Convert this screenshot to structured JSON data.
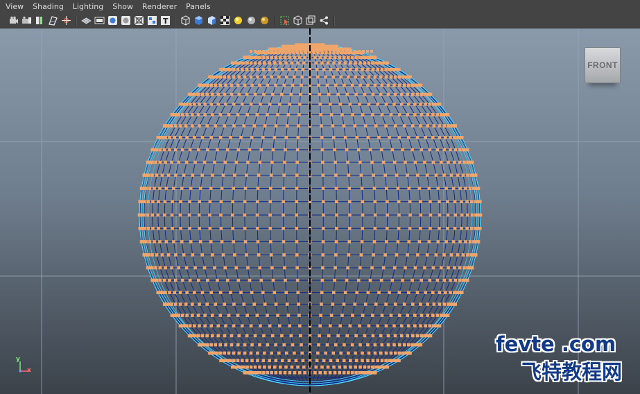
{
  "menu": {
    "items": [
      "View",
      "Shading",
      "Lighting",
      "Show",
      "Renderer",
      "Panels"
    ]
  },
  "toolbar": {
    "groups": [
      [
        "select-camera-icon",
        "camera-attributes-icon",
        "bookmarks-icon",
        "image-plane-icon",
        "two-d-pan-zoom-icon"
      ],
      [
        "grid-icon",
        "film-gate-icon",
        "resolution-gate-icon",
        "gate-mask-icon",
        "field-chart-icon",
        "safe-action-icon",
        "safe-title-icon"
      ],
      [
        "wireframe-icon",
        "smooth-shade-icon",
        "default-material-icon",
        "textured-icon",
        "use-all-lights-icon",
        "shadows-icon",
        "hardware-render-icon"
      ],
      [
        "isolate-select-icon",
        "xray-icon",
        "xray-joints-icon",
        "xray-components-icon"
      ]
    ]
  },
  "viewport": {
    "view_cube_label": "FRONT",
    "axis": {
      "y": "y",
      "x": "x"
    },
    "colors": {
      "wire_dark": "#0e2a88",
      "wire_light": "#56e0ff",
      "vertex": "#f0a66a",
      "grid": "#9aa8b6",
      "axis_line": "#000000"
    }
  },
  "watermark": {
    "line1": "fevte .com",
    "line2": "飞特教程网"
  }
}
